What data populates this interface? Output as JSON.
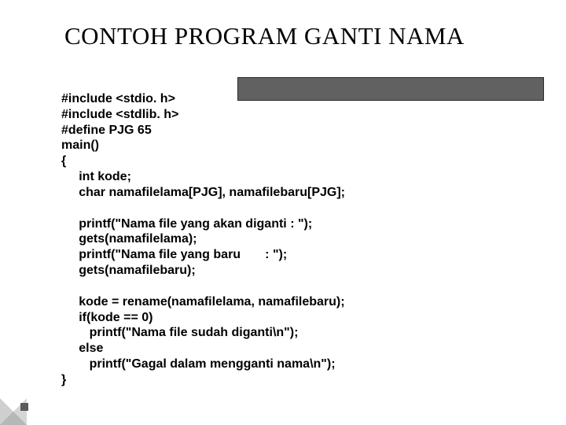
{
  "title": "CONTOH PROGRAM GANTI NAMA",
  "code": {
    "l1": "#include <stdio. h>",
    "l2": "#include <stdlib. h>",
    "l3": "#define PJG 65",
    "l4": "main()",
    "l5": "{",
    "l6": "     int kode;",
    "l7": "     char namafilelama[PJG], namafilebaru[PJG];",
    "l8": "",
    "l9": "     printf(\"Nama file yang akan diganti : \");",
    "l10": "     gets(namafilelama);",
    "l11": "     printf(\"Nama file yang baru       : \");",
    "l12": "     gets(namafilebaru);",
    "l13": "",
    "l14": "     kode = rename(namafilelama, namafilebaru);",
    "l15": "     if(kode == 0)",
    "l16": "        printf(\"Nama file sudah diganti\\n\");",
    "l17": "     else",
    "l18": "        printf(\"Gagal dalam mengganti nama\\n\");",
    "l19": "}"
  }
}
